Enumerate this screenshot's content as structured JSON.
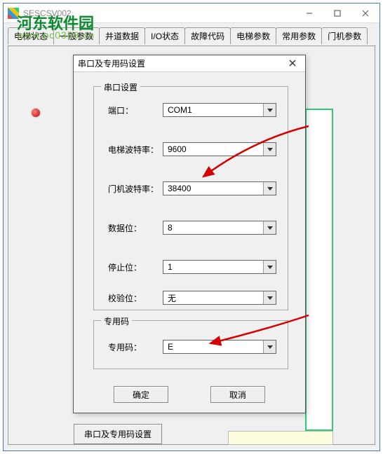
{
  "window": {
    "title": "SESCSV002",
    "tabs": [
      "电梯状态",
      "一般参数",
      "井道数据",
      "I/O状态",
      "故障代码",
      "电梯参数",
      "常用参数",
      "门机参数"
    ]
  },
  "watermark": {
    "line1": "河东软件园",
    "line2": "www.pc0359.cn"
  },
  "bottom_button": "串口及专用码设置",
  "dialog": {
    "title": "串口及专用码设置",
    "group_serial": "串口设置",
    "group_code": "专用码",
    "labels": {
      "port": "端口：",
      "elev_baud": "电梯波特率：",
      "door_baud": "门机波特率：",
      "data_bits": "数据位：",
      "stop_bits": "停止位：",
      "parity": "校验位：",
      "special": "专用码："
    },
    "values": {
      "port": "COM1",
      "elev_baud": "9600",
      "door_baud": "38400",
      "data_bits": "8",
      "stop_bits": "1",
      "parity": "无",
      "special": "E"
    },
    "ok": "确定",
    "cancel": "取消"
  }
}
